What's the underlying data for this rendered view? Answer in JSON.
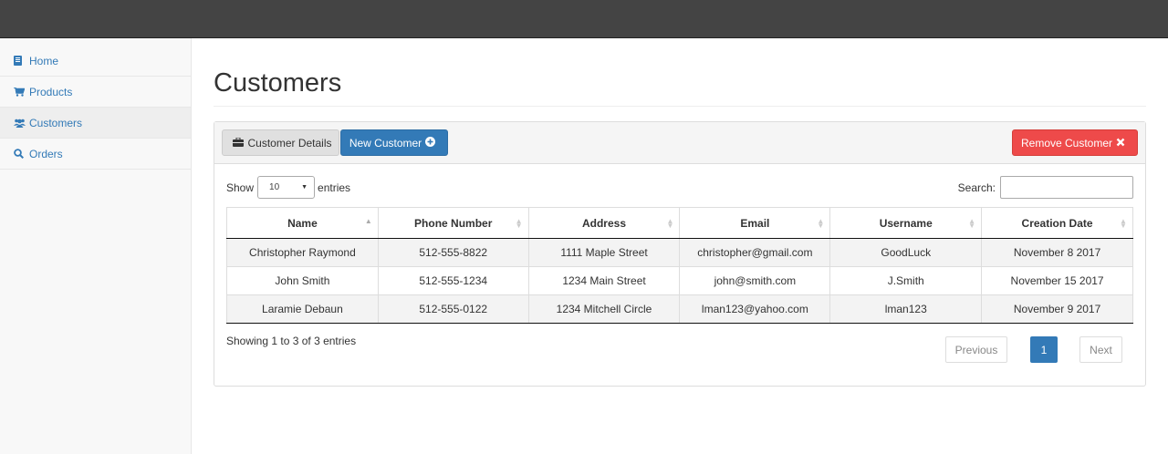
{
  "sidebar": {
    "items": [
      {
        "label": "Home",
        "icon": "book-icon"
      },
      {
        "label": "Products",
        "icon": "cart-icon"
      },
      {
        "label": "Customers",
        "icon": "users-icon"
      },
      {
        "label": "Orders",
        "icon": "search-icon"
      }
    ]
  },
  "main": {
    "title": "Customers"
  },
  "toolbar": {
    "details_label": "Customer Details",
    "new_label": "New Customer",
    "remove_label": "Remove Customer"
  },
  "table_controls": {
    "show_label": "Show",
    "page_size": "10",
    "entries_label": "entries",
    "search_label": "Search:",
    "search_value": ""
  },
  "table": {
    "headers": [
      "Name",
      "Phone Number",
      "Address",
      "Email",
      "Username",
      "Creation Date"
    ],
    "rows": [
      [
        "Christopher Raymond",
        "512-555-8822",
        "1111 Maple Street",
        "christopher@gmail.com",
        "GoodLuck",
        "November 8 2017"
      ],
      [
        "John Smith",
        "512-555-1234",
        "1234 Main Street",
        "john@smith.com",
        "J.Smith",
        "November 15 2017"
      ],
      [
        "Laramie Debaun",
        "512-555-0122",
        "1234 Mitchell Circle",
        "lman123@yahoo.com",
        "lman123",
        "November 9 2017"
      ]
    ]
  },
  "footer": {
    "info": "Showing 1 to 3 of 3 entries",
    "prev_label": "Previous",
    "page_label": "1",
    "next_label": "Next"
  },
  "colors": {
    "primary": "#337ab7",
    "danger": "#ee4a4a",
    "topbar": "#444444"
  }
}
